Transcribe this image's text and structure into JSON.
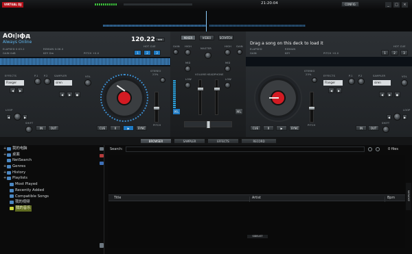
{
  "app": {
    "logo": "VIRTUAL DJ",
    "clock": "21:20:04",
    "config_label": "CONFIG"
  },
  "deck_left": {
    "title": "AOı|ıфд",
    "subtitle": "Always Online",
    "bpm": "120.22",
    "bpm_unit": "BPM",
    "elapsed_label": "ELAPSED 0:03.2",
    "remain_label": "REMAIN 0:06.0",
    "gain_label": "GAIN 0dB",
    "key_label": "KEY Dm",
    "pitch_label": "PITCH +0.0",
    "hot_cue_label": "HOT CUE",
    "hot_cues": [
      "1",
      "2",
      "3"
    ],
    "effects_label": "EFFECTS",
    "effect_value": "Flanger",
    "p1": "P.1",
    "p2": "P.2",
    "sampler_label": "SAMPLER",
    "sampler_value": "siren",
    "vol_label": "VOL",
    "loop_label": "LOOP",
    "shift_label": "SHIFT",
    "loop_in": "IN",
    "loop_out": "OUT",
    "cue_label": "CUE",
    "play_label": "▶",
    "pause_label": "II",
    "sync_label": "SYNC",
    "pitch_slider_label": "PITCH",
    "stereo_label": "STEREO",
    "stereo_val": "23%",
    "pfl_label": "PFL"
  },
  "deck_right": {
    "title": "Drag a song on this deck to load it",
    "elapsed_label": "ELAPSED",
    "remain_label": "REMAIN",
    "gain_label": "GAIN",
    "key_label": "KEY",
    "pitch_label": "PITCH +0.0",
    "hot_cue_label": "HOT CUE",
    "hot_cues": [
      "1",
      "2",
      "3"
    ],
    "effects_label": "EFFECTS",
    "effect_value": "Flanger",
    "p1": "P.1",
    "p2": "P.2",
    "sampler_label": "SAMPLER",
    "sampler_value": "siren",
    "vol_label": "VOL",
    "loop_label": "LOOP",
    "shift_label": "SHIFT",
    "loop_in": "IN",
    "loop_out": "OUT",
    "cue_label": "CUE",
    "play_label": "▶",
    "pause_label": "II",
    "sync_label": "SYNC",
    "pitch_slider_label": "PITCH",
    "stereo_label": "STEREO",
    "stereo_val": "23%",
    "pfl_label": "PFL"
  },
  "mixer": {
    "tabs": [
      "MIXER",
      "VIDEO",
      "SCRATCH"
    ],
    "active_tab": "MIXER",
    "gain": "GAIN",
    "high": "HIGH",
    "mid": "MID",
    "low": "LOW",
    "master": "MASTER",
    "volume": "VOLUME",
    "headphone": "HEADPHONE",
    "cue": "CUE",
    "pfl": "PFL"
  },
  "browser_tabs": [
    "BROWSER",
    "SAMPLER",
    "EFFECTS",
    "RECORD"
  ],
  "active_browser_tab": "BROWSER",
  "search": {
    "label": "Search:",
    "value": "",
    "count": "0 files"
  },
  "tree": [
    {
      "label": "我的电脑",
      "icon": "computer-icon",
      "expand": "+"
    },
    {
      "label": "桌面",
      "icon": "desktop-icon",
      "expand": "+"
    },
    {
      "label": "NetSearch",
      "icon": "netsearch-icon",
      "expand": ""
    },
    {
      "label": "Genres",
      "icon": "genres-icon",
      "expand": "+"
    },
    {
      "label": "History",
      "icon": "history-icon",
      "expand": "+"
    },
    {
      "label": "Playlists",
      "icon": "playlists-icon",
      "expand": "+"
    },
    {
      "label": "Most Played",
      "icon": "folder-icon",
      "expand": ""
    },
    {
      "label": "Recently Added",
      "icon": "folder-icon",
      "expand": ""
    },
    {
      "label": "Compatible Songs",
      "icon": "folder-icon",
      "expand": ""
    },
    {
      "label": "我的视频",
      "icon": "folder-icon",
      "expand": ""
    },
    {
      "label": "我的音乐",
      "icon": "folder-icon",
      "expand": ""
    }
  ],
  "table_headers": [
    "Title",
    "Artist",
    "Bpm"
  ],
  "sidelist_label": "SIDELIST",
  "karaoke_label": "KARAOKE",
  "colors": {
    "accent": "#2a9fd8",
    "platter_red": "#d31b23",
    "bg": "#0d0d0d"
  }
}
